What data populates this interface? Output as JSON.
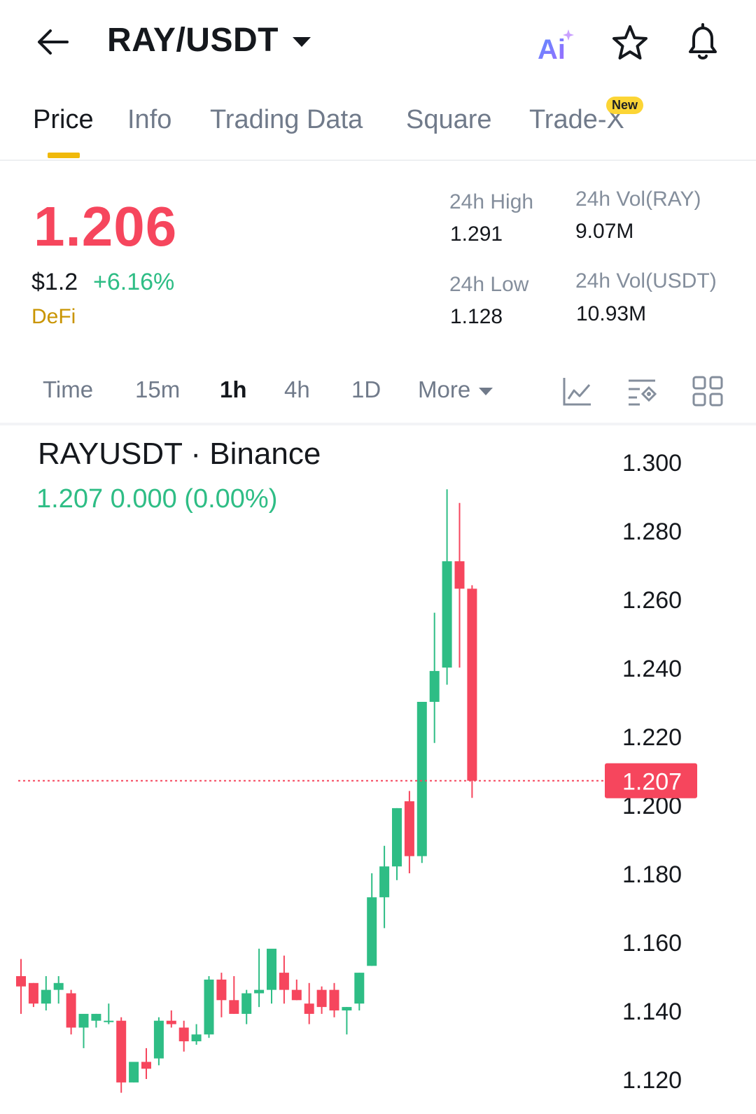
{
  "header": {
    "pair": "RAY/USDT",
    "back_icon": "arrow-left-icon",
    "ai_label": "Ai",
    "star_icon": "star-icon",
    "bell_icon": "bell-icon"
  },
  "tabs": [
    {
      "label": "Price",
      "active": true
    },
    {
      "label": "Info"
    },
    {
      "label": "Trading Data"
    },
    {
      "label": "Square"
    },
    {
      "label": "Trade-X",
      "badge": "New"
    }
  ],
  "price": {
    "last": "1.206",
    "usd": "$1.2",
    "change": "+6.16%",
    "tag": "DeFi"
  },
  "stats": {
    "high_label": "24h High",
    "high_value": "1.291",
    "low_label": "24h Low",
    "low_value": "1.128",
    "vol_base_label": "24h Vol(RAY)",
    "vol_base_value": "9.07M",
    "vol_quote_label": "24h Vol(USDT)",
    "vol_quote_value": "10.93M"
  },
  "intervals": {
    "time": "Time",
    "m15": "15m",
    "h1": "1h",
    "h4": "4h",
    "d1": "1D",
    "more": "More",
    "active": "1h"
  },
  "colors": {
    "up": "#2ebd85",
    "down": "#f6465d",
    "accent": "#f0b90b"
  },
  "chart_header": {
    "title": "RAYUSDT · Binance",
    "ohlc": "1.207  0.000 (0.00%)"
  },
  "chart_data": {
    "type": "candlestick",
    "ylim": [
      1.11,
      1.305
    ],
    "yticks": [
      "1.300",
      "1.280",
      "1.260",
      "1.240",
      "1.220",
      "1.200",
      "1.180",
      "1.160",
      "1.140",
      "1.120"
    ],
    "last_price_label": "1.207",
    "last_price": 1.207,
    "candles": [
      {
        "o": 1.15,
        "h": 1.155,
        "l": 1.139,
        "c": 1.147
      },
      {
        "o": 1.148,
        "h": 1.148,
        "l": 1.141,
        "c": 1.142
      },
      {
        "o": 1.142,
        "h": 1.15,
        "l": 1.14,
        "c": 1.146
      },
      {
        "o": 1.146,
        "h": 1.15,
        "l": 1.142,
        "c": 1.148
      },
      {
        "o": 1.145,
        "h": 1.146,
        "l": 1.133,
        "c": 1.135
      },
      {
        "o": 1.135,
        "h": 1.138,
        "l": 1.129,
        "c": 1.139
      },
      {
        "o": 1.137,
        "h": 1.139,
        "l": 1.135,
        "c": 1.139
      },
      {
        "o": 1.137,
        "h": 1.142,
        "l": 1.136,
        "c": 1.137
      },
      {
        "o": 1.137,
        "h": 1.138,
        "l": 1.116,
        "c": 1.119
      },
      {
        "o": 1.119,
        "h": 1.125,
        "l": 1.119,
        "c": 1.125
      },
      {
        "o": 1.125,
        "h": 1.129,
        "l": 1.12,
        "c": 1.123
      },
      {
        "o": 1.126,
        "h": 1.138,
        "l": 1.124,
        "c": 1.137
      },
      {
        "o": 1.137,
        "h": 1.14,
        "l": 1.135,
        "c": 1.136
      },
      {
        "o": 1.135,
        "h": 1.137,
        "l": 1.128,
        "c": 1.131
      },
      {
        "o": 1.131,
        "h": 1.136,
        "l": 1.13,
        "c": 1.133
      },
      {
        "o": 1.133,
        "h": 1.15,
        "l": 1.132,
        "c": 1.149
      },
      {
        "o": 1.149,
        "h": 1.151,
        "l": 1.138,
        "c": 1.143
      },
      {
        "o": 1.143,
        "h": 1.15,
        "l": 1.139,
        "c": 1.139
      },
      {
        "o": 1.139,
        "h": 1.146,
        "l": 1.136,
        "c": 1.145
      },
      {
        "o": 1.145,
        "h": 1.158,
        "l": 1.141,
        "c": 1.146
      },
      {
        "o": 1.146,
        "h": 1.157,
        "l": 1.142,
        "c": 1.158
      },
      {
        "o": 1.151,
        "h": 1.156,
        "l": 1.142,
        "c": 1.146
      },
      {
        "o": 1.146,
        "h": 1.149,
        "l": 1.143,
        "c": 1.143
      },
      {
        "o": 1.142,
        "h": 1.148,
        "l": 1.136,
        "c": 1.139
      },
      {
        "o": 1.146,
        "h": 1.147,
        "l": 1.139,
        "c": 1.141
      },
      {
        "o": 1.146,
        "h": 1.148,
        "l": 1.138,
        "c": 1.14
      },
      {
        "o": 1.14,
        "h": 1.141,
        "l": 1.133,
        "c": 1.141
      },
      {
        "o": 1.142,
        "h": 1.151,
        "l": 1.14,
        "c": 1.151
      },
      {
        "o": 1.153,
        "h": 1.18,
        "l": 1.153,
        "c": 1.173
      },
      {
        "o": 1.173,
        "h": 1.188,
        "l": 1.164,
        "c": 1.182
      },
      {
        "o": 1.182,
        "h": 1.199,
        "l": 1.178,
        "c": 1.199
      },
      {
        "o": 1.201,
        "h": 1.204,
        "l": 1.18,
        "c": 1.185
      },
      {
        "o": 1.185,
        "h": 1.228,
        "l": 1.183,
        "c": 1.23
      },
      {
        "o": 1.23,
        "h": 1.256,
        "l": 1.218,
        "c": 1.239
      },
      {
        "o": 1.24,
        "h": 1.292,
        "l": 1.235,
        "c": 1.271
      },
      {
        "o": 1.271,
        "h": 1.288,
        "l": 1.24,
        "c": 1.263
      },
      {
        "o": 1.263,
        "h": 1.264,
        "l": 1.202,
        "c": 1.207
      }
    ]
  }
}
